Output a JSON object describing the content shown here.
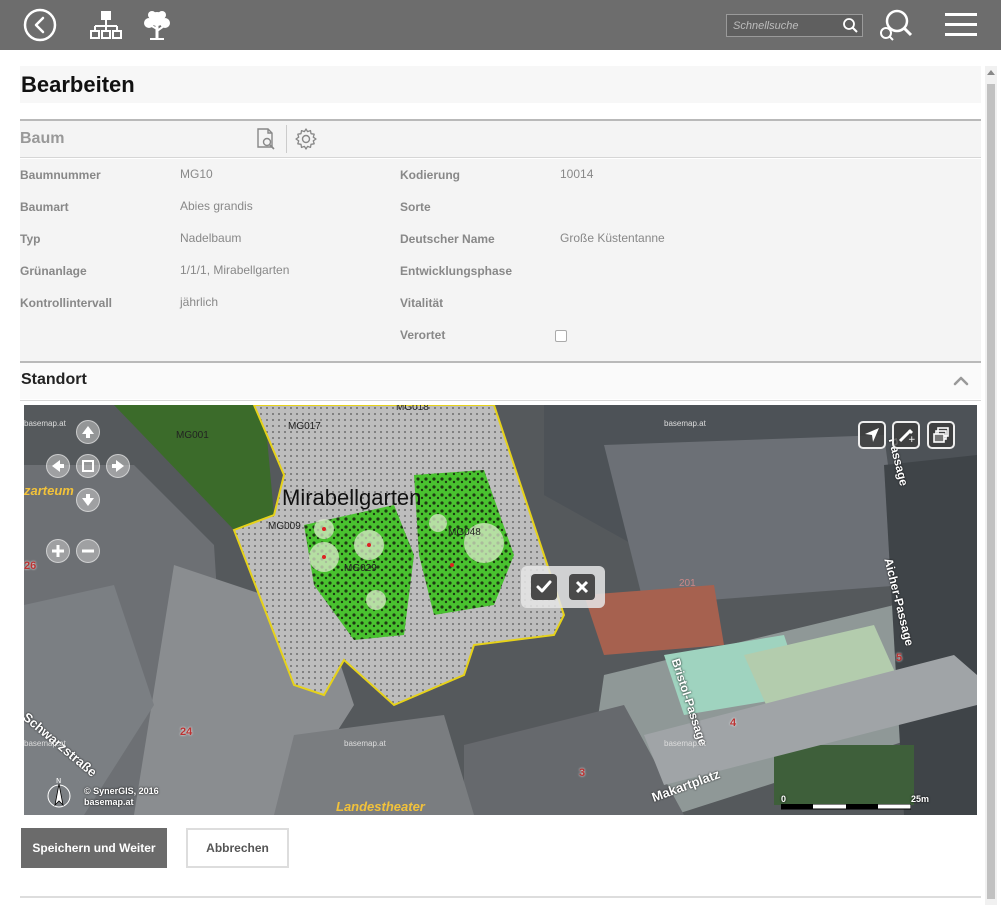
{
  "topbar": {
    "search_placeholder": "Schnellsuche",
    "icons": [
      "back-icon",
      "hierarchy-icon",
      "tree-icon",
      "search-icon",
      "zoom-search-icon",
      "menu-icon"
    ]
  },
  "page_title": "Bearbeiten",
  "section_baum": {
    "label": "Baum",
    "icons": [
      "document-search-icon",
      "gear-icon"
    ]
  },
  "attributes": {
    "left": [
      {
        "label": "Baumnummer",
        "value": "MG10"
      },
      {
        "label": "Baumart",
        "value": "Abies grandis"
      },
      {
        "label": "Typ",
        "value": "Nadelbaum"
      },
      {
        "label": "Grünanlage",
        "value": "1/1/1, Mirabellgarten"
      },
      {
        "label": "Kontrollintervall",
        "value": "jährlich"
      }
    ],
    "right": [
      {
        "label": "Kodierung",
        "value": "10014"
      },
      {
        "label": "Sorte",
        "value": ""
      },
      {
        "label": "Deutscher Name",
        "value": "Große Küstentanne"
      },
      {
        "label": "Entwicklungsphase",
        "value": ""
      },
      {
        "label": "Vitalität",
        "value": ""
      },
      {
        "label": "Verortet",
        "value": ""
      }
    ],
    "verortet_checked": false
  },
  "standort": {
    "label": "Standort"
  },
  "map": {
    "area_label": "Mirabellgarten",
    "polygon_labels": [
      "MG001",
      "MG017",
      "MG018",
      "MG009",
      "MG029",
      "MG048"
    ],
    "street_labels": [
      "zarteum",
      "Landestheater",
      "Makartplatz",
      "Bristol-Passage",
      "Aicher-Passage",
      "Passage",
      "Schwarzstraße"
    ],
    "house_numbers": [
      "26",
      "24",
      "5",
      "4",
      "3",
      "201"
    ],
    "tile_watermark": "basemap.at",
    "copyright_line1": "© SynerGIS, 2016",
    "copyright_line2": "basemap.at",
    "scale_start": "0",
    "scale_end": "25m",
    "colors": {
      "park_green": "#3fbf2a",
      "boundary": "#e6d21a",
      "hatch_area": "#b9b9b9"
    }
  },
  "buttons": {
    "save": "Speichern und Weiter",
    "cancel": "Abbrechen"
  }
}
